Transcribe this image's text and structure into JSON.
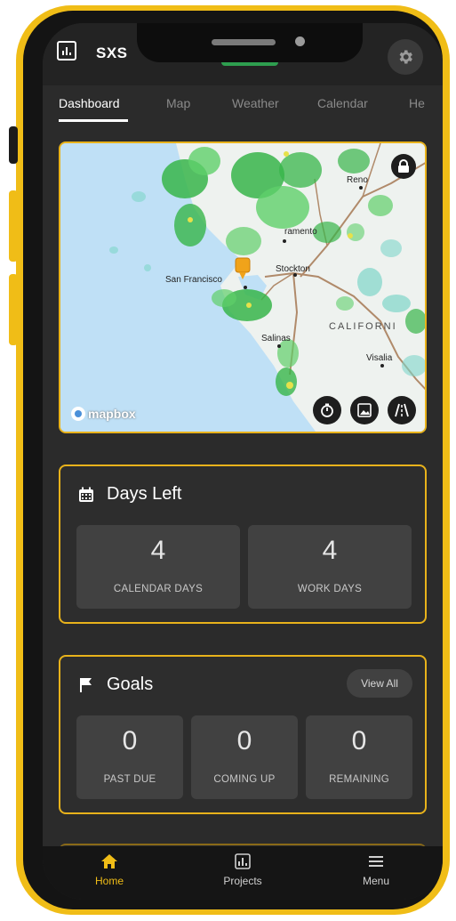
{
  "app": {
    "title": "SXS",
    "accent_color": "#f0bd17"
  },
  "tabs": [
    {
      "label": "Dashboard",
      "active": true
    },
    {
      "label": "Map",
      "active": false
    },
    {
      "label": "Weather",
      "active": false
    },
    {
      "label": "Calendar",
      "active": false
    },
    {
      "label": "He",
      "active": false
    }
  ],
  "map": {
    "attribution": "mapbox",
    "labels": {
      "reno": "Reno",
      "sacramento": "ramento",
      "stockton": "Stockton",
      "san_francisco": "San Francisco",
      "california": "CALIFORNI",
      "salinas": "Salinas",
      "visalia": "Visalia"
    },
    "controls": [
      "timer-icon",
      "image-layers-icon",
      "road-icon"
    ],
    "lock_icon": "lock-icon",
    "marker_color": "#f0a31a"
  },
  "days_left": {
    "title": "Days Left",
    "icon": "calendar-icon",
    "stats": [
      {
        "value": "4",
        "label": "CALENDAR DAYS"
      },
      {
        "value": "4",
        "label": "WORK DAYS"
      }
    ]
  },
  "goals": {
    "title": "Goals",
    "icon": "flag-icon",
    "view_all_label": "View All",
    "stats": [
      {
        "value": "0",
        "label": "PAST DUE"
      },
      {
        "value": "0",
        "label": "COMING UP"
      },
      {
        "value": "0",
        "label": "REMAINING"
      }
    ]
  },
  "bottom_nav": [
    {
      "label": "Home",
      "icon": "home-icon",
      "active": true
    },
    {
      "label": "Projects",
      "icon": "chart-icon",
      "active": false
    },
    {
      "label": "Menu",
      "icon": "hamburger-icon",
      "active": false
    }
  ]
}
